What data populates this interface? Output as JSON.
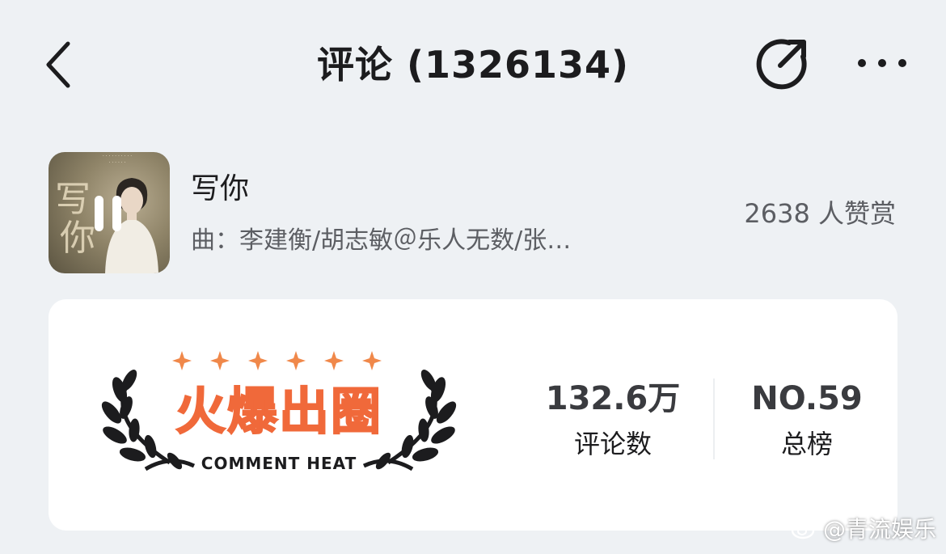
{
  "header": {
    "title": "评论 (1326134)"
  },
  "song": {
    "title": "写你",
    "credits": "曲：李建衡/胡志敏＠乐人无数/张…",
    "reward_count": "2638 人赞赏",
    "cover_calligraphy": [
      "写",
      "你"
    ]
  },
  "heat_card": {
    "badge_title": "火爆出圈",
    "badge_subtitle": "COMMENT HEAT",
    "stars_count": 6,
    "comment_count": "132.6万",
    "comment_label": "评论数",
    "rank": "NO.59",
    "rank_label": "总榜",
    "colors": {
      "badge_orange": "#f0693a",
      "star_orange": "#f0884a",
      "laurel": "#1c1c1e"
    }
  },
  "watermark": {
    "text": "@青流娱乐"
  }
}
